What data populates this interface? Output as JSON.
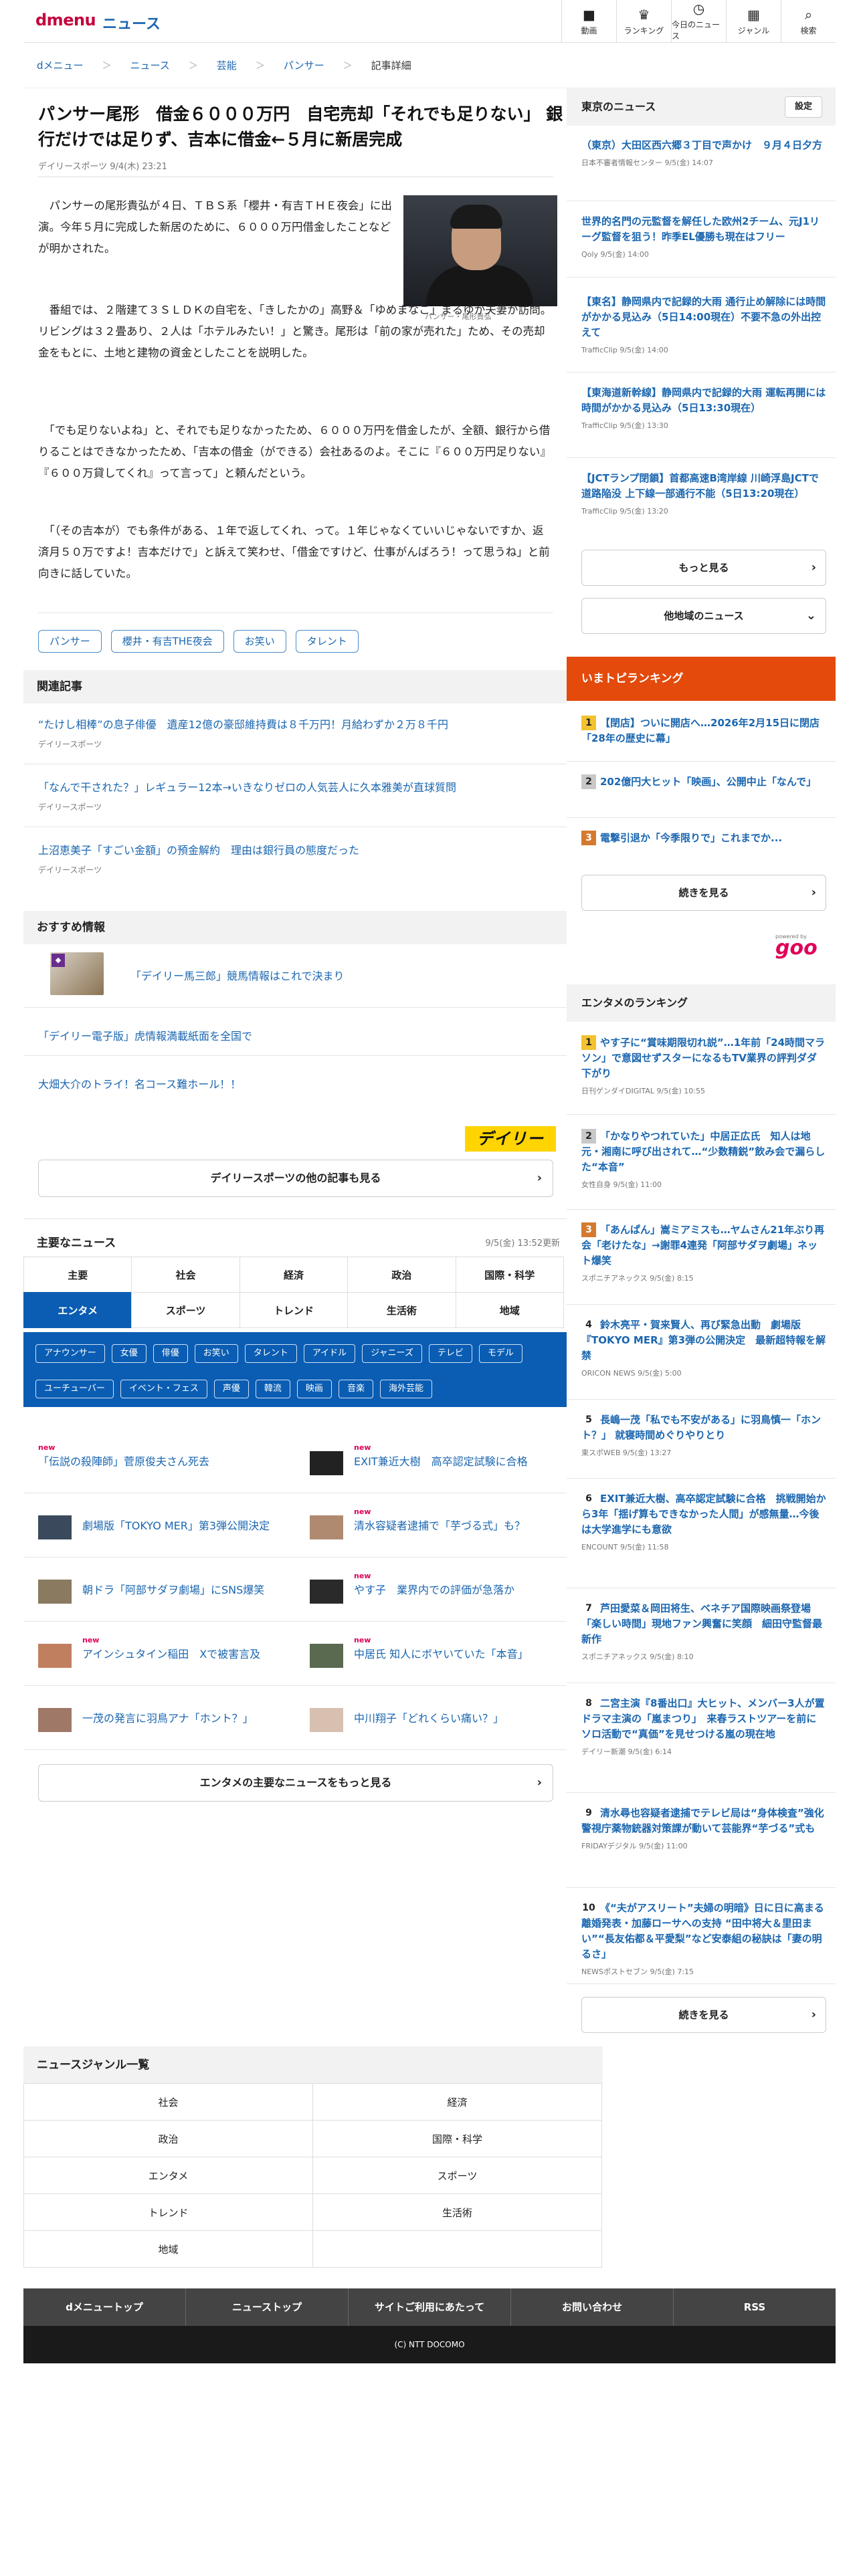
{
  "header": {
    "logo": "dmenu",
    "section": "ニュース",
    "nav": [
      {
        "icon": "video-icon",
        "glyph": "■",
        "label": "動画"
      },
      {
        "icon": "trophy-icon",
        "glyph": "♛",
        "label": "ランキング"
      },
      {
        "icon": "clock-icon",
        "glyph": "◷",
        "label": "今日のニュース"
      },
      {
        "icon": "grid-icon",
        "glyph": "▦",
        "label": "ジャンル"
      },
      {
        "icon": "search-icon",
        "glyph": "⌕",
        "label": "検索"
      }
    ]
  },
  "breadcrumb": [
    "dメニュー",
    "ニュース",
    "芸能",
    "パンサー",
    "記事詳細"
  ],
  "article": {
    "title": "パンサー尾形　借金６０００万円　自宅売却「それでも足りない」 銀行だけでは足りず、吉本に借金←５月に新居完成",
    "meta": "デイリースポーツ 9/4(木) 23:21",
    "caption": "パンサー・尾形貴弘",
    "p1": "　パンサーの尾形貴弘が４日、ＴＢＳ系「櫻井・有吉ＴＨＥ夜会」に出演。今年５月に完成した新居のために、６０００万円借金したことなどが明かされた。",
    "p2": "　番組では、２階建て３ＳＬＤＫの自宅を、「きしたかの」高野＆「ゆめまなこ」まるゆか夫妻が訪問。リビングは３２畳あり、２人は「ホテルみたい！」と驚き。尾形は「前の家が売れた」ため、その売却金をもとに、土地と建物の資金としたことを説明した。",
    "p3": "　「でも足りないよね」と、それでも足りなかったため、６０００万円を借金したが、全額、銀行から借りることはできなかったため、「吉本の借金（ができる）会社あるのよ。そこに『６００万円足りない』『６００万貸してくれ』って言って」と頼んだという。",
    "p4": "　「（その吉本が）でも条件がある、１年で返してくれ、って。１年じゃなくていいじゃないですか、返済月５０万ですよ！吉本だけで」と訴えて笑わせ、「借金ですけど、仕事がんばろう！って思うね」と前向きに話していた。",
    "tags": [
      "パンサー",
      "櫻井・有吉THE夜会",
      "お笑い",
      "タレント"
    ]
  },
  "related": {
    "heading": "関連記事",
    "items": [
      {
        "title": "“たけし相棒”の息子俳優　遺産12億の豪邸維持費は８千万円！月給わずか２万８千円",
        "source": "デイリースポーツ"
      },
      {
        "title": "「なんで干された？」レギュラー12本→いきなりゼロの人気芸人に久本雅美が直球質問",
        "source": "デイリースポーツ"
      },
      {
        "title": "上沼恵美子「すごい金額」の預金解約　理由は銀行員の態度だった",
        "source": "デイリースポーツ"
      }
    ]
  },
  "osusume": {
    "heading": "おすすめ情報",
    "items": [
      "「デイリー馬三郎」競馬情報はこれで決まり",
      "「デイリー電子版」虎情報満載紙面を全国で",
      "大畑大介のトライ！名コース難ホール！！"
    ],
    "brand": "デイリー",
    "more": "デイリースポーツの他の記事も見る"
  },
  "major": {
    "heading": "主要なニュース",
    "updated": "9/5(金) 13:52更新",
    "tabs1": [
      "主要",
      "社会",
      "経済",
      "政治",
      "国際・科学"
    ],
    "tabs2": [
      "エンタメ",
      "スポーツ",
      "トレンド",
      "生活術",
      "地域"
    ],
    "keywords": [
      "アナウンサー",
      "女優",
      "俳優",
      "お笑い",
      "タレント",
      "アイドル",
      "ジャニーズ",
      "テレビ",
      "モデル",
      "ユーチューバー",
      "イベント・フェス",
      "声優",
      "韓流",
      "映画",
      "音楽",
      "海外芸能"
    ],
    "items": [
      {
        "new": "new",
        "title": "「伝説の殺陣師」菅原俊夫さん死去"
      },
      {
        "new": "new",
        "title": "EXIT兼近大樹　高卒認定試験に合格"
      },
      {
        "new": "",
        "title": "劇場版「TOKYO MER」第3弾公開決定"
      },
      {
        "new": "new",
        "title": "清水容疑者逮捕で「芋づる式」も？"
      },
      {
        "new": "",
        "title": "朝ドラ「阿部サダヲ劇場」にSNS爆笑"
      },
      {
        "new": "new",
        "title": "やす子　業界内での評価が急落か"
      },
      {
        "new": "new",
        "title": "アインシュタイン稲田　Xで被害言及"
      },
      {
        "new": "new",
        "title": "中居氏 知人にボヤいていた「本音」"
      },
      {
        "new": "",
        "title": "一茂の発言に羽鳥アナ「ホント？」"
      },
      {
        "new": "",
        "title": "中川翔子「どれくらい痛い？」"
      }
    ],
    "more": "エンタメの主要なニュースをもっと見る"
  },
  "side": {
    "tokyo": {
      "heading": "東京のニュース",
      "setting": "設定",
      "items": [
        {
          "title": "（東京）大田区西六郷３丁目で声かけ　９月４日夕方",
          "source": "日本不審者情報センター 9/5(金) 14:07"
        },
        {
          "title": "世界的名門の元監督を解任した欧州2チーム、元J1リーグ監督を狙う！昨季EL優勝も現在はフリー",
          "source": "Qoly 9/5(金) 14:00"
        },
        {
          "title": "【東名】静岡県内で記録的大雨 通行止め解除には時間がかかる見込み（5日14:00現在）不要不急の外出控えて",
          "source": "TrafficClip 9/5(金) 14:00"
        },
        {
          "title": "【東海道新幹線】静岡県内で記録的大雨 運転再開には時間がかかる見込み（5日13:30現在）",
          "source": "TrafficClip 9/5(金) 13:30"
        },
        {
          "title": "【JCTランプ閉鎖】首都高速B湾岸線 川崎浮島JCTで道路陥没 上下線一部通行不能（5日13:20現在）",
          "source": "TrafficClip 9/5(金) 13:20"
        }
      ],
      "more": "もっと見る",
      "region": "他地域のニュース"
    },
    "toppi": {
      "heading": "いまトピランキング",
      "items": [
        {
          "rank": "1",
          "title": "【閉店】ついに開店へ…2026年2月15日に閉店「28年の歴史に幕」"
        },
        {
          "rank": "2",
          "title": "202億円大ヒット「映画」、公開中止「なんで」"
        },
        {
          "rank": "3",
          "title": "電撃引退か「今季限りで」これまでか..."
        }
      ],
      "more": "続きを見る",
      "powered": "powered by",
      "brand": "goo"
    },
    "entame": {
      "heading": "エンタメのランキング",
      "items": [
        {
          "rank": "1",
          "title": "やす子に“賞味期限切れ説”…1年前「24時間マラソン」で意図せずスターになるもTV業界の評判ダダ下がり",
          "source": "日刊ゲンダイDIGITAL 9/5(金) 10:55"
        },
        {
          "rank": "2",
          "title": "「かなりやつれていた」中居正広氏　知人は地元・湘南に呼び出されて…“少数精鋭”飲み会で漏らした“本音”",
          "source": "女性自身 9/5(金) 11:00"
        },
        {
          "rank": "3",
          "title": "「あんぱん」嵩ミアミスも…ヤムさん21年ぶり再会「老けたな」→謝罪4連発「阿部サダヲ劇場」ネット爆笑",
          "source": "スポニチアネックス 9/5(金) 8:15"
        },
        {
          "rank": "4",
          "title": "鈴木亮平・賀来賢人、再び緊急出動　劇場版『TOKYO MER』第3弾の公開決定　最新超特報を解禁",
          "source": "ORICON NEWS 9/5(金) 5:00"
        },
        {
          "rank": "5",
          "title": "長嶋一茂「私でも不安がある」に羽鳥慎一「ホント？」 就寝時間めぐりやりとり",
          "source": "東スポWEB 9/5(金) 13:27"
        },
        {
          "rank": "6",
          "title": "EXIT兼近大樹、高卒認定試験に合格　挑戦開始から3年「揺げ算もできなかった人間」が感無量…今後は大学進学にも意欲",
          "source": "ENCOUNT 9/5(金) 11:58"
        },
        {
          "rank": "7",
          "title": "芦田愛菜＆岡田将生、ベネチア国際映画祭登場「楽しい時間」現地ファン興奮に笑顔　細田守監督最新作",
          "source": "スポニチアネックス 9/5(金) 8:10"
        },
        {
          "rank": "8",
          "title": "二宮主演『8番出口』大ヒット、メンバー3人が置ドラマ主演の「嵐まつり」　来春ラストツアーを前にソロ活動で“真価”を見せつける嵐の現在地",
          "source": "デイリー新潮 9/5(金) 6:14"
        },
        {
          "rank": "9",
          "title": "清水尋也容疑者逮捕でテレビ局は“身体検査”強化　警視庁薬物銃器対策課が動いて芸能界“芋づる”式も",
          "source": "FRIDAYデジタル 9/5(金) 11:00"
        },
        {
          "rank": "10",
          "title": "《“夫がアスリート”夫婦の明暗》日に日に高まる離婚発表・加藤ローサへの支持 “田中将大＆里田まい”“長友佑都＆平愛梨”など安泰組の秘訣は「妻の明るさ」",
          "source": "NEWSポストセブン 9/5(金) 7:15"
        }
      ],
      "more": "続きを見る"
    }
  },
  "genre": {
    "heading": "ニュースジャンル一覧",
    "items": [
      "社会",
      "経済",
      "政治",
      "国際・科学",
      "エンタメ",
      "スポーツ",
      "トレンド",
      "生活術",
      "地域"
    ]
  },
  "footer": {
    "links": [
      "dメニュートップ",
      "ニューストップ",
      "サイトご利用にあたって",
      "お問い合わせ",
      "RSS"
    ],
    "copyright": "(C) NTT DOCOMO"
  }
}
